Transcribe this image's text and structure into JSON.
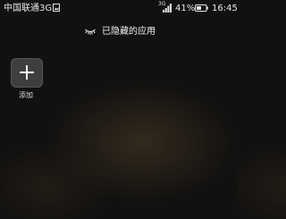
{
  "status_bar": {
    "carrier": "中国联通3G",
    "network_type": "3G",
    "battery_percent": "41%",
    "time": "16:45",
    "icons": [
      "image-notification-icon",
      "signal-icon",
      "battery-icon"
    ]
  },
  "header": {
    "title": "已隐藏的应用",
    "icon": "eye-closed-icon"
  },
  "apps": [
    {
      "label": "添加",
      "icon": "plus-icon"
    }
  ]
}
